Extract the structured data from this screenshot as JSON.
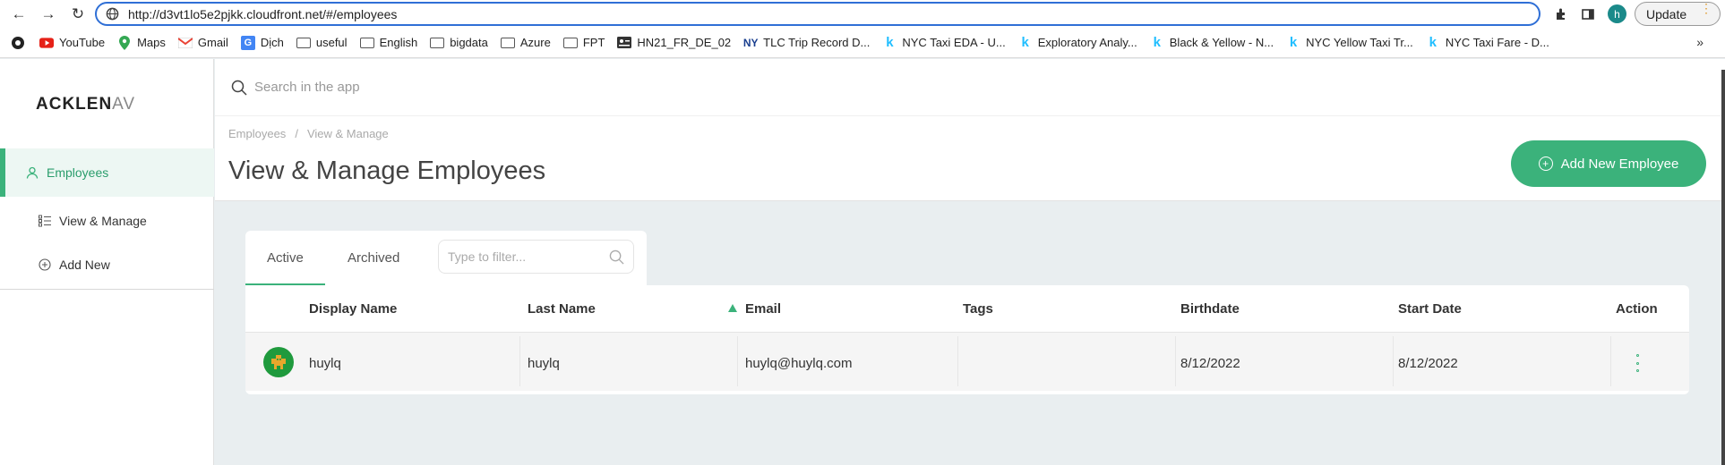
{
  "browser": {
    "url": "http://d3vt1lo5e2pjkk.cloudfront.net/#/employees",
    "profile_initial": "h",
    "update_label": "Update"
  },
  "bookmarks": [
    {
      "label": "YouTube",
      "icon": "youtube-icon"
    },
    {
      "label": "Maps",
      "icon": "maps-icon"
    },
    {
      "label": "Gmail",
      "icon": "gmail-icon"
    },
    {
      "label": "Dịch",
      "icon": "translate-icon"
    },
    {
      "label": "useful",
      "icon": "folder-icon"
    },
    {
      "label": "English",
      "icon": "folder-icon"
    },
    {
      "label": "bigdata",
      "icon": "folder-icon"
    },
    {
      "label": "Azure",
      "icon": "folder-icon"
    },
    {
      "label": "FPT",
      "icon": "folder-icon"
    },
    {
      "label": "HN21_FR_DE_02",
      "icon": "id-card-icon"
    },
    {
      "label": "TLC Trip Record D...",
      "icon": "nyc-icon"
    },
    {
      "label": "NYC Taxi EDA - U...",
      "icon": "kaggle-icon"
    },
    {
      "label": "Exploratory Analy...",
      "icon": "kaggle-icon"
    },
    {
      "label": "Black & Yellow - N...",
      "icon": "kaggle-icon"
    },
    {
      "label": "NYC Yellow Taxi Tr...",
      "icon": "kaggle-icon"
    },
    {
      "label": "NYC Taxi Fare - D...",
      "icon": "kaggle-icon"
    }
  ],
  "app": {
    "logo_bold": "ACKLEN",
    "logo_light": "AV",
    "search_placeholder": "Search in the app",
    "sidebar": [
      {
        "label": "Employees",
        "icon": "person-icon"
      },
      {
        "label": "View & Manage",
        "icon": "list-icon"
      },
      {
        "label": "Add New",
        "icon": "plus-circle-icon"
      }
    ],
    "breadcrumb": [
      "Employees",
      "View & Manage"
    ],
    "breadcrumb_sep": "/",
    "page_title": "View & Manage Employees",
    "add_button": "Add New Employee",
    "tabs": [
      "Active",
      "Archived"
    ],
    "filter_placeholder": "Type to filter...",
    "columns": [
      "Display Name",
      "Last Name",
      "Email",
      "Tags",
      "Birthdate",
      "Start Date",
      "Action"
    ],
    "rows": [
      {
        "display_name": "huylq",
        "last_name": "huylq",
        "email": "huylq@huylq.com",
        "tags": "",
        "birthdate": "8/12/2022",
        "start_date": "8/12/2022"
      }
    ]
  },
  "colors": {
    "accent": "#3bb27b",
    "browser_focus": "#2f6fd6"
  }
}
